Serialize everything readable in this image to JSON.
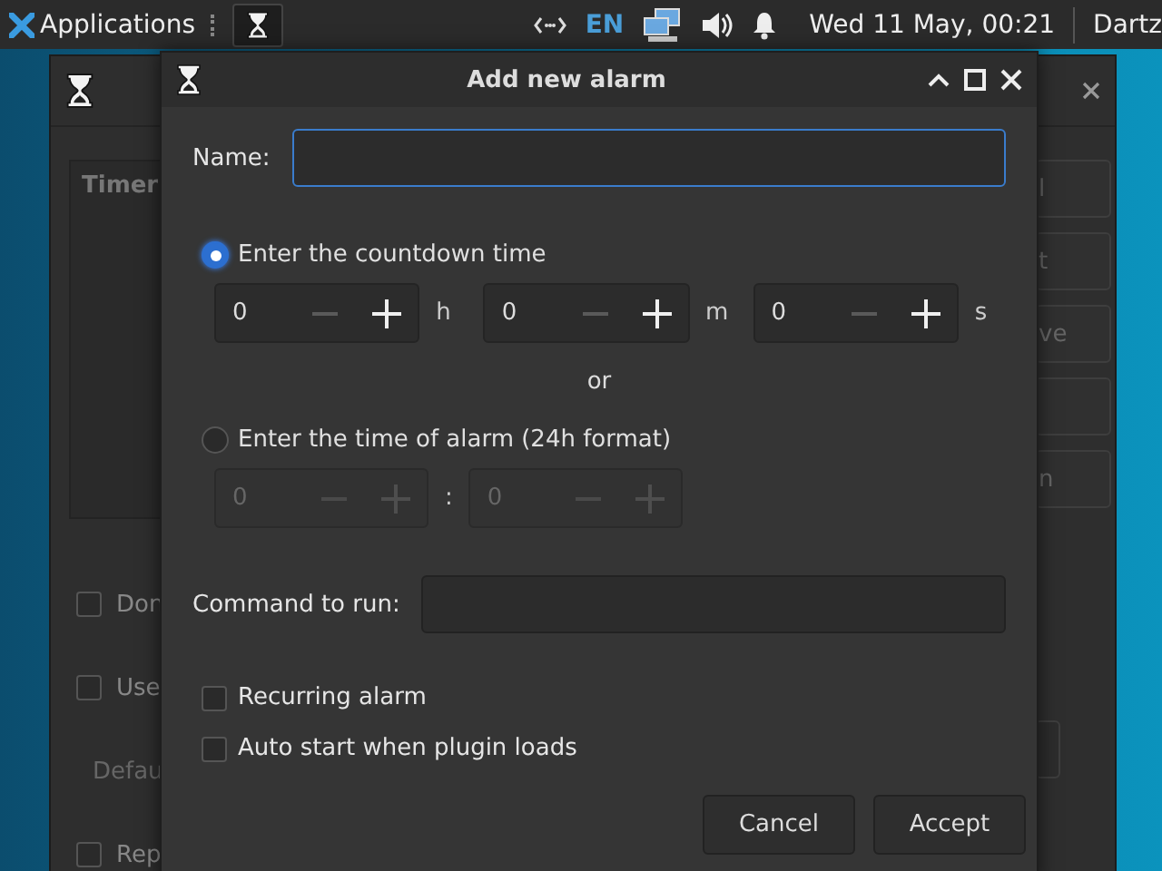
{
  "panel": {
    "menu_label": "Applications",
    "language": "EN",
    "clock": "Wed 11 May, 00:21",
    "user": "Dartz"
  },
  "back_window": {
    "list_header": "Timer",
    "buttons": [
      {
        "kind": "labeled",
        "label": "l"
      },
      {
        "kind": "labeled",
        "label": "t"
      },
      {
        "kind": "labeled",
        "label": "ve"
      },
      {
        "kind": "blank"
      },
      {
        "kind": "labeled",
        "label": "n"
      }
    ],
    "options": [
      {
        "kind": "checkbox",
        "label": "Don",
        "checked": false
      },
      {
        "kind": "checkbox",
        "label": "Use",
        "checked": false
      },
      {
        "kind": "label",
        "label": "Defau"
      },
      {
        "kind": "checkbox",
        "label": "Rep",
        "checked": false
      }
    ]
  },
  "dialog": {
    "title": "Add new alarm",
    "name_label": "Name:",
    "countdown": {
      "label": "Enter the countdown time",
      "selected": true,
      "disabled": false,
      "spinners": [
        {
          "value": "0",
          "unit": "h"
        },
        {
          "value": "0",
          "unit": "m"
        },
        {
          "value": "0",
          "unit": "s"
        }
      ]
    },
    "or_label": "or",
    "alarm_time": {
      "label": "Enter the time of alarm (24h format)",
      "selected": false,
      "disabled": true,
      "separator": ":",
      "spinners": [
        {
          "value": "0"
        },
        {
          "value": "0"
        }
      ]
    },
    "command_label": "Command to run:",
    "checkboxes": [
      {
        "label": "Recurring alarm",
        "checked": false
      },
      {
        "label": "Auto start when plugin loads",
        "checked": false
      }
    ],
    "buttons": [
      "Cancel",
      "Accept"
    ]
  }
}
